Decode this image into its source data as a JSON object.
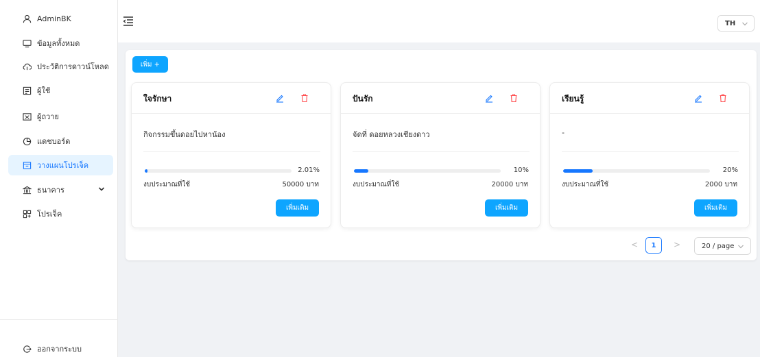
{
  "sidebar": {
    "items": [
      {
        "label": "AdminBK",
        "icon": "user-icon"
      },
      {
        "label": "ข้อมูลทั้งหมด",
        "icon": "monitor-icon"
      },
      {
        "label": "ประวัติการดาวน์โหลด",
        "icon": "cloud-icon"
      },
      {
        "label": "ผู้ใช้",
        "icon": "users-list-icon"
      },
      {
        "label": "ผู้ถวาย",
        "icon": "id-card-icon"
      },
      {
        "label": "แดชบอร์ด",
        "icon": "pie-chart-icon"
      },
      {
        "label": "วางแผนโปรเจ็ค",
        "icon": "calendar-icon",
        "active": true
      },
      {
        "label": "ธนาคาร",
        "icon": "bank-icon"
      },
      {
        "label": "โปรเจ็ค",
        "icon": "project-icon"
      }
    ],
    "logout": {
      "label": "ออกจากระบบ",
      "icon": "logout-icon"
    }
  },
  "header": {
    "language": "TH"
  },
  "toolbar": {
    "add_label": "เพิ่ม +"
  },
  "cards": [
    {
      "title": "ใจรักษา",
      "description": "กิจกรรมขึ้นดอยไปหาน้อง",
      "progress_percent": 2.01,
      "progress_label": "2.01%",
      "budget_label": "งบประมาณที่ใช้",
      "budget_value": "50000 บาท",
      "more_label": "เพิ่มเติม"
    },
    {
      "title": "ปันรัก",
      "description": "จัดที่ ดอยหลวงเชียงดาว",
      "progress_percent": 10,
      "progress_label": "10%",
      "budget_label": "งบประมาณที่ใช้",
      "budget_value": "20000 บาท",
      "more_label": "เพิ่มเติม"
    },
    {
      "title": "เรียนรู้",
      "description": "-",
      "progress_percent": 20,
      "progress_label": "20%",
      "budget_label": "งบประมาณที่ใช้",
      "budget_value": "2000 บาท",
      "more_label": "เพิ่มเติม"
    }
  ],
  "pagination": {
    "prev": "<",
    "current": "1",
    "next": ">",
    "page_size": "20 / page"
  },
  "colors": {
    "accent": "#1677ff",
    "button": "#0ea5ff",
    "delete": "#ff4d4f",
    "active_bg": "#e6f4ff"
  }
}
